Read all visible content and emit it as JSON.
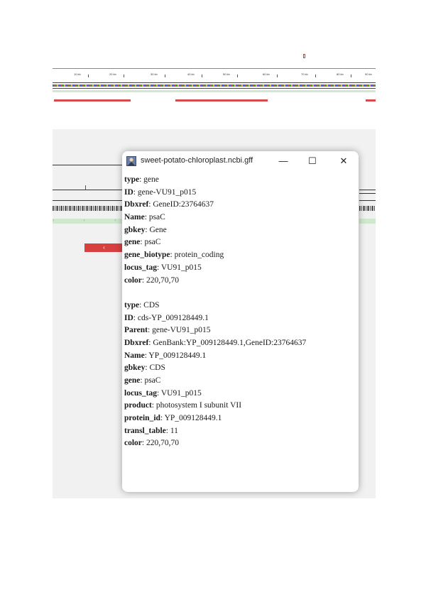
{
  "window": {
    "title": "sweet-potato-chloroplast.ncbi.gff",
    "icon": "app-icon",
    "controls": {
      "minimize": "—",
      "maximize": "☐",
      "close": "✕"
    }
  },
  "background_browser": {
    "ruler_labels": [
      "10 kb",
      "20 kb",
      "30 kb",
      "40 kb",
      "50 kb",
      "60 kb",
      "70 kb",
      "80 kb",
      "90 kb"
    ],
    "center_label": "",
    "nav_arrow": "‹",
    "chevron_text": "› › › ›"
  },
  "records": [
    {
      "fields": [
        {
          "key": "type",
          "value": "gene"
        },
        {
          "key": "ID",
          "value": "gene-VU91_p015"
        },
        {
          "key": "Dbxref",
          "value": "GeneID:23764637"
        },
        {
          "key": "Name",
          "value": "psaC"
        },
        {
          "key": "gbkey",
          "value": "Gene"
        },
        {
          "key": "gene",
          "value": "psaC"
        },
        {
          "key": "gene_biotype",
          "value": "protein_coding"
        },
        {
          "key": "locus_tag",
          "value": "VU91_p015"
        },
        {
          "key": "color",
          "value": "220,70,70"
        }
      ]
    },
    {
      "fields": [
        {
          "key": "type",
          "value": "CDS"
        },
        {
          "key": "ID",
          "value": "cds-YP_009128449.1"
        },
        {
          "key": "Parent",
          "value": "gene-VU91_p015"
        },
        {
          "key": "Dbxref",
          "value": "GenBank:YP_009128449.1,GeneID:23764637"
        },
        {
          "key": "Name",
          "value": "YP_009128449.1"
        },
        {
          "key": "gbkey",
          "value": "CDS"
        },
        {
          "key": "gene",
          "value": "psaC"
        },
        {
          "key": "locus_tag",
          "value": "VU91_p015"
        },
        {
          "key": "product",
          "value": "photosystem I subunit VII"
        },
        {
          "key": "protein_id",
          "value": "YP_009128449.1"
        },
        {
          "key": "transl_table",
          "value": "11"
        },
        {
          "key": "color",
          "value": "220,70,70"
        }
      ]
    }
  ]
}
